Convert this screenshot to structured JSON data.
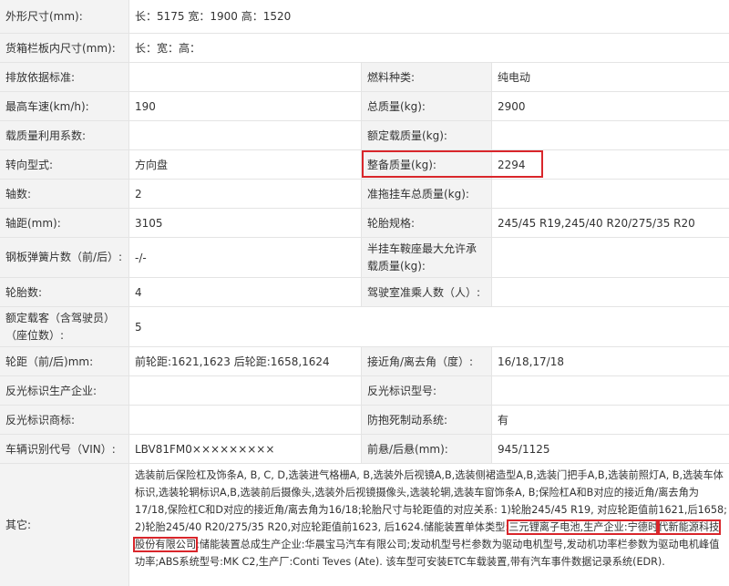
{
  "rows": [
    {
      "label": "外形尺寸(mm):",
      "value": "长：5175 宽：1900 高：1520"
    },
    {
      "label": "货箱栏板内尺寸(mm):",
      "value": "长：宽：高："
    },
    {
      "label": "排放依据标准:",
      "value": "",
      "label2": "燃料种类:",
      "value2": "纯电动"
    },
    {
      "label": "最高车速(km/h):",
      "value": "190",
      "label2": "总质量(kg):",
      "value2": "2900"
    },
    {
      "label": "载质量利用系数:",
      "value": "",
      "label2": "额定载质量(kg):",
      "value2": ""
    },
    {
      "label": "转向型式:",
      "value": "方向盘",
      "label2": "整备质量(kg):",
      "value2": "2294"
    },
    {
      "label": "轴数:",
      "value": "2",
      "label2": "准拖挂车总质量(kg):",
      "value2": ""
    },
    {
      "label": "轴距(mm):",
      "value": "3105",
      "label2": "轮胎规格:",
      "value2": "245/45 R19,245/40 R20/275/35 R20"
    },
    {
      "label": "钢板弹簧片数（前/后）:",
      "value": "-/-",
      "label2": "半挂车鞍座最大允许承载质量(kg):",
      "value2": ""
    },
    {
      "label": "轮胎数:",
      "value": "4",
      "label2": "驾驶室准乘人数（人）:",
      "value2": ""
    },
    {
      "label": "额定载客（含驾驶员）（座位数）:",
      "value": "5"
    },
    {
      "label": "轮距（前/后)mm:",
      "value": "前轮距:1621,1623 后轮距:1658,1624",
      "label2": "接近角/离去角（度）:",
      "value2": "16/18,17/18"
    },
    {
      "label": "反光标识生产企业:",
      "value": "",
      "label2": "反光标识型号:",
      "value2": ""
    },
    {
      "label": "反光标识商标:",
      "value": "",
      "label2": "防抱死制动系统:",
      "value2": "有"
    },
    {
      "label": "车辆识别代号（VIN）:",
      "value": "LBV81FM0×××××××××",
      "label2": "前悬/后悬(mm):",
      "value2": "945/1125"
    }
  ],
  "other": {
    "label": "其它:",
    "lines": [
      "选装前后保险杠及饰条A, B, C, D,选装进气格栅A, B,选装外后视镜A,B,选装侧裙造型A,B,选装门把手A,B,选装前照灯A, B,选装",
      "车体标识,选装轮辋标识A,B,选装前后摄像头,选装外后视镜摄像头,选装轮辋,选装车窗饰条A, B;保险杠A和B对应的接近角/离去",
      "角为17/18,保险杠C和D对应的接近角/离去角为16/18;轮胎尺寸与轮距值的对应关系: 1)轮胎245/45 R19, 对应轮距值前162",
      "1,后1658; 2)轮胎245/40 R20/275/35 R20,对应轮距值前1623, 后1624.储能装置单体类型:",
      "三元锂离子电池,生产企业:宁德时",
      "代新能源科技股份有限公司",
      ";储能装置总成生产企业:华晨宝马汽车有限公司;发动机型号栏参数为",
      "驱动电机型号,发动机功率栏",
      "参数为驱动电机峰值功率;ABS系统型号:MK C2,生产厂:Conti Teves (Ate). 该车型可安装ETC车载装置,带有汽车事件数据",
      "记录系统(EDR)."
    ]
  }
}
